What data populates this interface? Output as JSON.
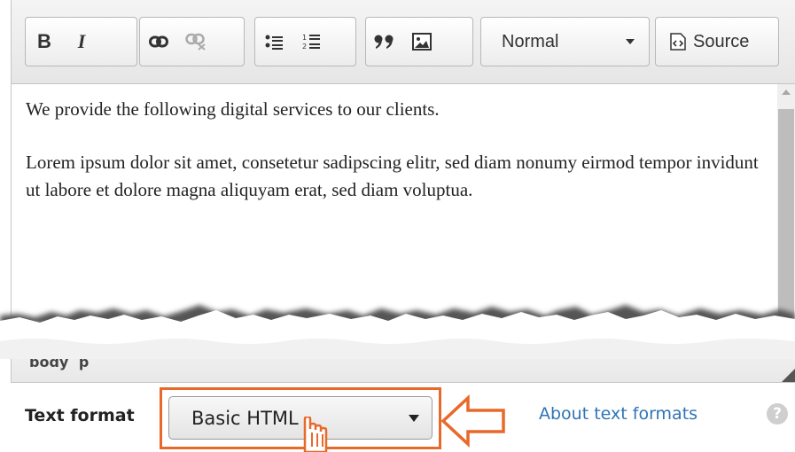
{
  "toolbar": {
    "bold_label": "B",
    "italic_label": "I",
    "format_value": "Normal",
    "source_label": "Source"
  },
  "content": {
    "paragraphs": [
      "We provide the following digital services to our clients.",
      "Lorem ipsum dolor sit amet, consetetur sadipscing elitr, sed diam nonumy eirmod tempor invidunt ut labore et dolore magna aliquyam erat, sed diam voluptua."
    ]
  },
  "statusbar": {
    "path": [
      "body",
      "p"
    ]
  },
  "text_format": {
    "label": "Text format",
    "selected": "Basic HTML",
    "about_link": "About text formats",
    "help_symbol": "?"
  },
  "colors": {
    "highlight": "#e8692a",
    "link": "#2f74b5"
  }
}
